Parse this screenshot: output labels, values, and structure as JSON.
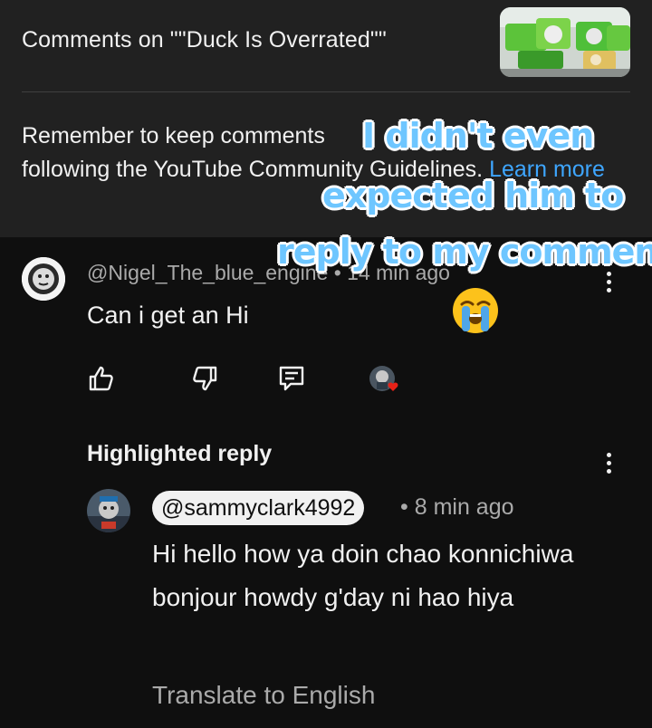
{
  "header": {
    "title": "Comments on \"\"Duck Is Overrated\"\"",
    "thumbnail_icon": "video-thumbnail"
  },
  "guidelines": {
    "text": "Remember to keep comments respectful and to follow our following the YouTube Community Guidelines.",
    "text_visible_line1": "Remember to keep comments",
    "text_visible_line2": "following the YouTube Community Guidelines.",
    "link": "Learn more"
  },
  "comment": {
    "author": "@Nigel_The_blue_engine",
    "time": "14 min ago",
    "separator": "•",
    "text": "Can i get an Hi",
    "actions": {
      "like_icon": "thumbs-up-icon",
      "dislike_icon": "thumbs-down-icon",
      "reply_icon": "reply-icon",
      "creator_heart_icon": "creator-heart-icon"
    }
  },
  "highlighted": {
    "label": "Highlighted reply",
    "handle": "@sammyclark4992",
    "time": "8 min ago",
    "separator": "•",
    "text": "Hi hello how ya doin chao konnichiwa bonjour howdy g'day ni hao hiya",
    "translate": "Translate to English"
  },
  "overlay_caption": {
    "line1": "I didn't even",
    "line2": "expected him to",
    "line3": "reply to my commen",
    "emoji": "crying-face-emoji"
  },
  "colors": {
    "background": "#0f0f0f",
    "panel": "#212121",
    "link": "#3ea6ff",
    "caption": "#6ec6ff",
    "heart": "#e62117"
  }
}
